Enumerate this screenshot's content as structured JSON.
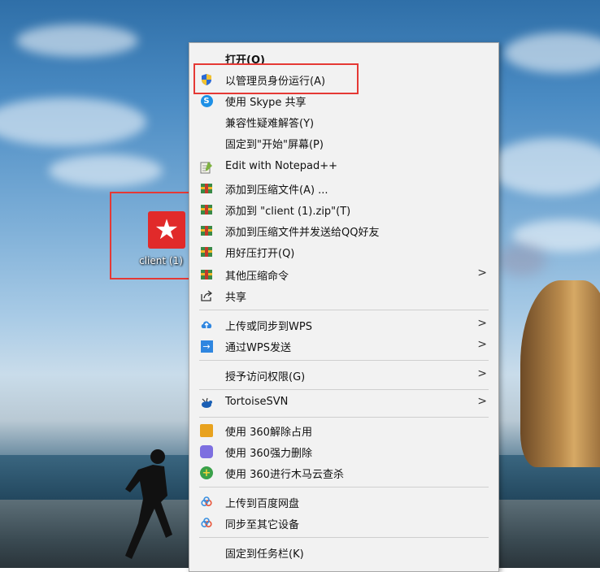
{
  "desktop": {
    "icon_label": "client (1)"
  },
  "context_menu": {
    "items": [
      {
        "label": "打开(O)",
        "icon": "none"
      },
      {
        "label": "以管理员身份运行(A)",
        "icon": "shield-icon",
        "color": "#2a6ad6"
      },
      {
        "label": "使用 Skype 共享",
        "icon": "skype-icon",
        "color": "#1e90e6"
      },
      {
        "label": "兼容性疑难解答(Y)",
        "icon": "none"
      },
      {
        "label": "固定到\"开始\"屏幕(P)",
        "icon": "none"
      },
      {
        "label": "Edit with Notepad++",
        "icon": "notepad-icon",
        "color": "#7fb241"
      },
      {
        "label": "添加到压缩文件(A) ...",
        "icon": "archive-icon",
        "color": "#2b7a3a"
      },
      {
        "label": "添加到 \"client (1).zip\"(T)",
        "icon": "archive-icon",
        "color": "#2b7a3a"
      },
      {
        "label": "添加到压缩文件并发送给QQ好友",
        "icon": "archive-icon",
        "color": "#2b7a3a"
      },
      {
        "label": "用好压打开(Q)",
        "icon": "archive-icon",
        "color": "#2b7a3a"
      },
      {
        "label": "其他压缩命令",
        "icon": "archive-icon",
        "color": "#2b7a3a",
        "submenu": ">"
      },
      {
        "label": "共享",
        "icon": "share-icon"
      },
      {
        "label": "上传或同步到WPS",
        "icon": "cloud-upload-icon",
        "color": "#2f86e0",
        "submenu": ">"
      },
      {
        "label": "通过WPS发送",
        "icon": "send-arrow-icon",
        "color": "#2f86e0",
        "submenu": ">"
      },
      {
        "label": "授予访问权限(G)",
        "icon": "none",
        "submenu": ">"
      },
      {
        "label": "TortoiseSVN",
        "icon": "tortoise-icon",
        "color": "#1a5fb4",
        "submenu": ">"
      },
      {
        "label": "使用 360解除占用",
        "icon": "unlock-360-icon",
        "color": "#e8a21e"
      },
      {
        "label": "使用 360强力删除",
        "icon": "shredder-360-icon",
        "color": "#7d6fe0"
      },
      {
        "label": "使用 360进行木马云查杀",
        "icon": "scan-360-icon",
        "color": "#3aa14a"
      },
      {
        "label": "上传到百度网盘",
        "icon": "baidu-cloud-icon",
        "color": "#3a8fe0"
      },
      {
        "label": "同步至其它设备",
        "icon": "baidu-sync-icon",
        "color": "#3a8fe0"
      },
      {
        "label": "固定到任务栏(K)",
        "icon": "none"
      }
    ]
  },
  "highlight_color": "#e53935"
}
